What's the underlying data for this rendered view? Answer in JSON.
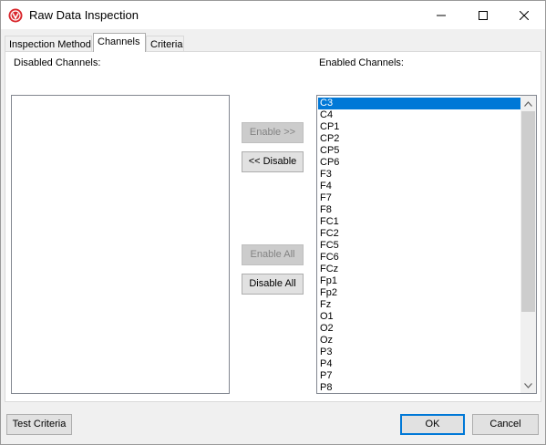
{
  "window": {
    "title": "Raw Data Inspection"
  },
  "tabs": [
    {
      "label": "Inspection Method",
      "active": false
    },
    {
      "label": "Channels",
      "active": true
    },
    {
      "label": "Criteria",
      "active": false
    }
  ],
  "channels": {
    "disabled_label": "Disabled Channels:",
    "enabled_label": "Enabled Channels:",
    "disabled_items": [],
    "enabled_items": [
      "C3",
      "C4",
      "CP1",
      "CP2",
      "CP5",
      "CP6",
      "F3",
      "F4",
      "F7",
      "F8",
      "FC1",
      "FC2",
      "FC5",
      "FC6",
      "FCz",
      "Fp1",
      "Fp2",
      "Fz",
      "O1",
      "O2",
      "Oz",
      "P3",
      "P4",
      "P7",
      "P8"
    ],
    "selected_item": "C3",
    "buttons": {
      "enable": "Enable >>",
      "disable": "<< Disable",
      "enable_all": "Enable All",
      "disable_all": "Disable All"
    }
  },
  "footer": {
    "test_criteria": "Test Criteria",
    "ok": "OK",
    "cancel": "Cancel"
  },
  "colors": {
    "selection": "#0078d7",
    "app_icon": "#d9262c"
  }
}
